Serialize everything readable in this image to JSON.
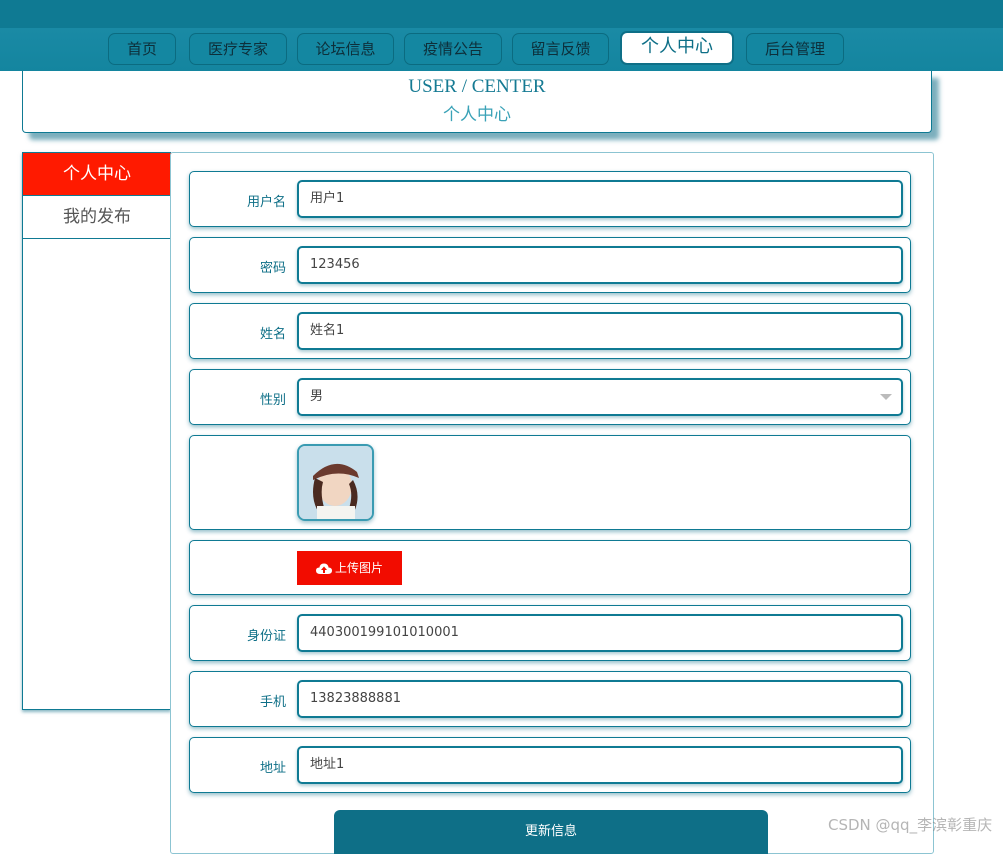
{
  "nav": {
    "items": [
      {
        "label": "首页"
      },
      {
        "label": "医疗专家"
      },
      {
        "label": "论坛信息"
      },
      {
        "label": "疫情公告"
      },
      {
        "label": "留言反馈"
      },
      {
        "label": "个人中心",
        "active": true
      },
      {
        "label": "后台管理"
      }
    ]
  },
  "header": {
    "title_en": "USER / CENTER",
    "title_cn": "个人中心"
  },
  "sidebar": {
    "items": [
      {
        "label": "个人中心",
        "active": true
      },
      {
        "label": "我的发布"
      }
    ]
  },
  "form": {
    "username": {
      "label": "用户名",
      "value": "用户1"
    },
    "password": {
      "label": "密码",
      "value": "123456"
    },
    "name": {
      "label": "姓名",
      "value": "姓名1"
    },
    "gender": {
      "label": "性别",
      "value": "男"
    },
    "avatar": {
      "icon": "avatar-photo"
    },
    "upload": {
      "label": "上传图片",
      "icon": "cloud-upload-icon"
    },
    "id_card": {
      "label": "身份证",
      "value": "440300199101010001"
    },
    "phone": {
      "label": "手机",
      "value": "13823888881"
    },
    "address": {
      "label": "地址",
      "value": "地址1"
    },
    "submit_label": "更新信息"
  },
  "watermark": "CSDN @qq_李滨彰重庆"
}
